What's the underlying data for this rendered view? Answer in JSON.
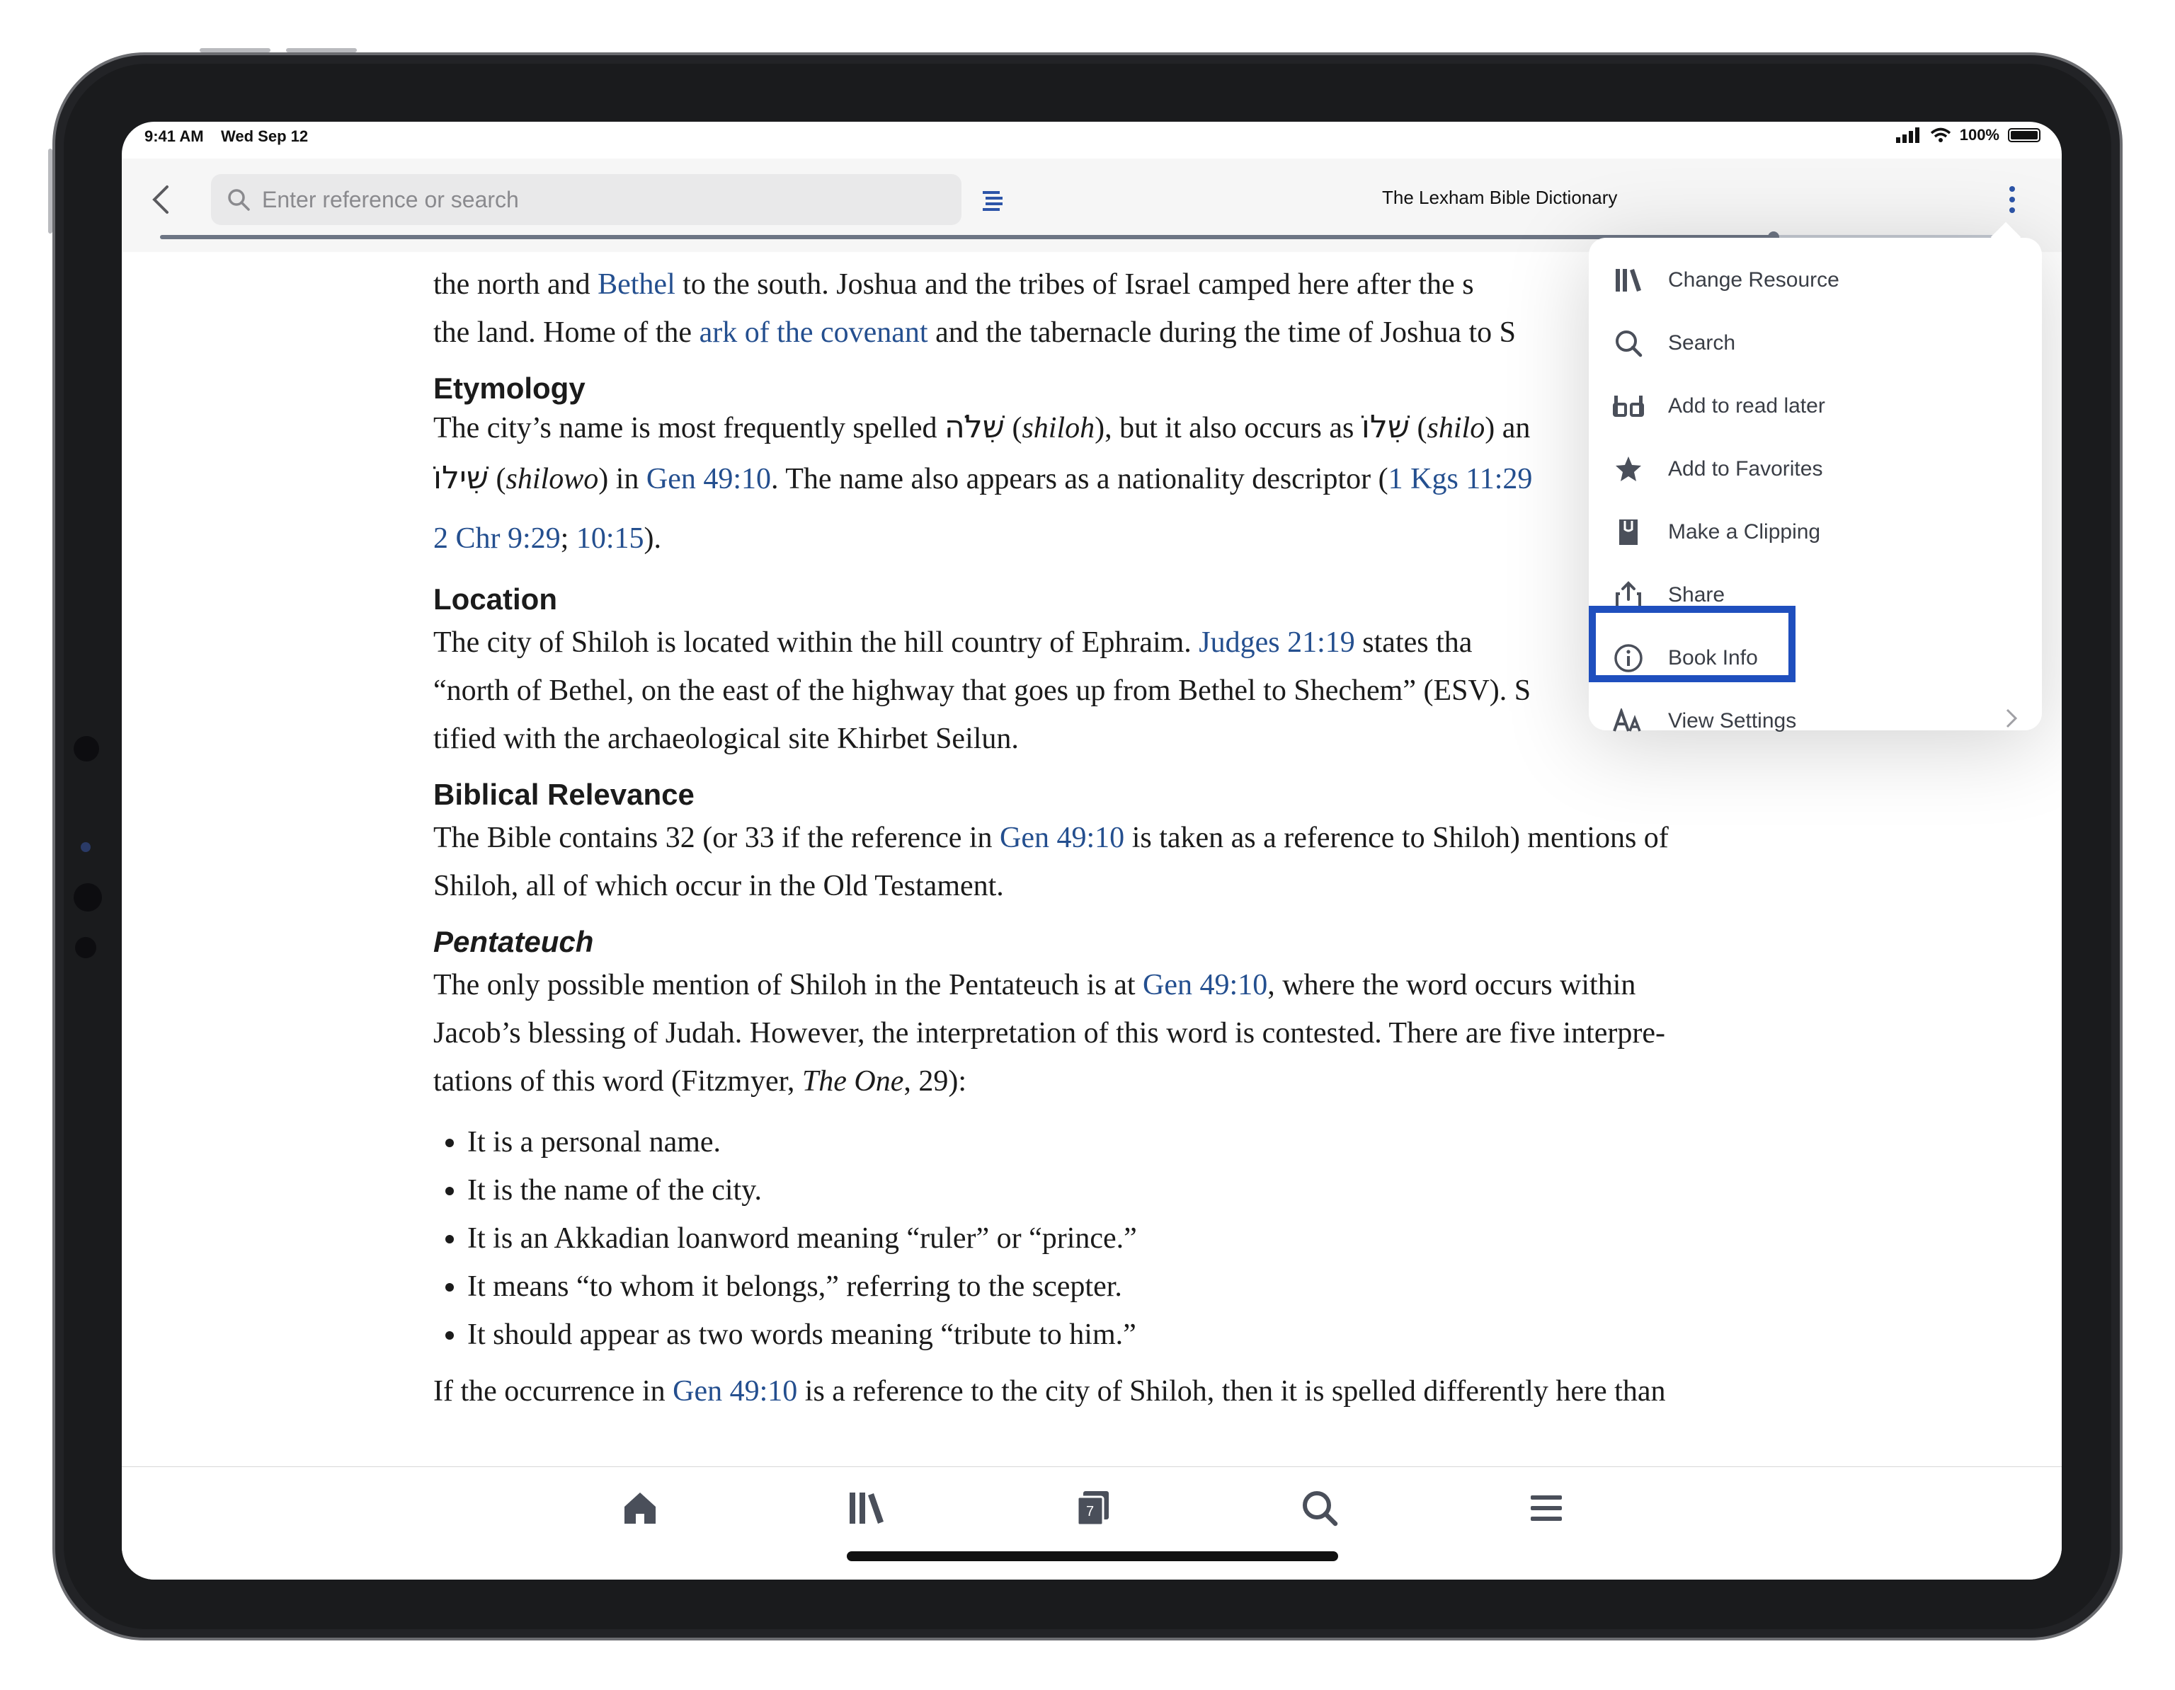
{
  "status_bar": {
    "time": "9:41 AM",
    "date": "Wed Sep 12",
    "battery": "100%"
  },
  "toolbar": {
    "search_placeholder": "Enter reference or search",
    "document_title": "The Lexham Bible Dictionary"
  },
  "reading_progress": 0.88,
  "article": {
    "intro_lines": [
      {
        "parts": [
          {
            "t": "the north and "
          },
          {
            "t": "Bethel",
            "link": true
          },
          {
            "t": " to the south. Joshua and the tribes of Israel camped here after the s"
          }
        ]
      },
      {
        "parts": [
          {
            "t": "the land. Home of the "
          },
          {
            "t": "ark of the covenant",
            "link": true
          },
          {
            "t": " and the tabernacle during the time of Joshua to S"
          }
        ]
      }
    ],
    "etymology": {
      "heading": "Etymology",
      "text1": "The city’s name is most frequently spelled ",
      "hebrew1": "שִׁלֹה",
      "translit1": "shiloh",
      "text2": "), but it also occurs as ",
      "hebrew2": "שִׁלוֹ",
      "translit2": "shilo",
      "text3": ") an",
      "hebrew3": "שִׁילוֹ",
      "translit3": "shilowo",
      "text4": ") in ",
      "ref1": "Gen 49:10",
      "text5": ". The name also appears as a nationality descriptor (",
      "ref2": "1 Kgs 11:29",
      "ref3": "2 Chr 9:29",
      "ref4": "10:15",
      "text6": ")."
    },
    "location": {
      "heading": "Location",
      "text1": "The city of Shiloh is located within the hill country of Ephraim. ",
      "ref1": "Judges 21:19",
      "text2": " states tha",
      "line2": "“north of Bethel, on the east of the highway that goes up from Bethel to Shechem” (ESV). S",
      "line3": "tified with the archaeological site Khirbet Seilun."
    },
    "biblical_relevance": {
      "heading": "Biblical Relevance",
      "text1": "The Bible contains 32 (or 33 if the reference in ",
      "ref1": "Gen 49:10",
      "text2": " is taken as a reference to Shiloh) mentions of",
      "line2": "Shiloh, all of which occur in the Old Testament."
    },
    "pentateuch": {
      "heading": "Pentateuch",
      "text1": "The only possible mention of Shiloh in the Pentateuch is at ",
      "ref1": "Gen 49:10",
      "text2": ", where the word occurs within",
      "line2": "Jacob’s blessing of Judah. However, the interpretation of this word is contested. There are five interpre-",
      "line3a": "tations of this word (Fitzmyer, ",
      "line3_italic": "The One",
      "line3b": ", 29):",
      "bullets": [
        "It is a personal name.",
        "It is the name of the city.",
        "It is an Akkadian loanword meaning “ruler” or “prince.”",
        "It means “to whom it belongs,” referring to the scepter.",
        "It should appear as two words meaning “tribute to him.”"
      ],
      "last_text1": "If the occurrence in ",
      "last_ref": "Gen 49:10",
      "last_text2": " is a reference to the city of Shiloh, then it is spelled differently here than"
    }
  },
  "menu": {
    "items": [
      {
        "label": "Change Resource",
        "icon": "library-icon"
      },
      {
        "label": "Search",
        "icon": "search-icon"
      },
      {
        "label": "Add to read later",
        "icon": "read-later-icon"
      },
      {
        "label": "Add to Favorites",
        "icon": "star-icon"
      },
      {
        "label": "Make a Clipping",
        "icon": "clipping-icon"
      },
      {
        "label": "Share",
        "icon": "share-icon"
      },
      {
        "label": "Book Info",
        "icon": "info-icon"
      },
      {
        "label": "View Settings",
        "icon": "text-size-icon"
      }
    ],
    "highlighted": "Book Info"
  },
  "tabbar": {
    "items": [
      "home-icon",
      "library-icon",
      "panels-icon",
      "search-icon",
      "menu-icon"
    ],
    "panels_count": "7"
  },
  "colors": {
    "link": "#244f8f",
    "icon_gray": "#4a4f5a",
    "highlight": "#1f4fbe"
  }
}
